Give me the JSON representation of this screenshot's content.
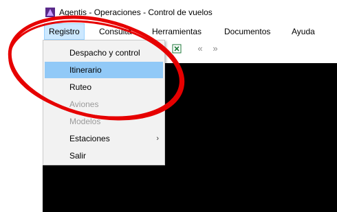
{
  "window": {
    "title": "Agentis - Operaciones - Control de vuelos",
    "icon": "app-icon"
  },
  "menubar": {
    "items": [
      {
        "label": "Registro"
      },
      {
        "label": "Consulta"
      },
      {
        "label": "Herramientas"
      },
      {
        "label": "Documentos"
      },
      {
        "label": "Ayuda"
      }
    ]
  },
  "dropdown": {
    "items": [
      {
        "label": "Despacho y control",
        "state": "normal"
      },
      {
        "label": "Itinerario",
        "state": "highlighted"
      },
      {
        "label": "Ruteo",
        "state": "normal"
      },
      {
        "label": "Aviones",
        "state": "disabled"
      },
      {
        "label": "Modelos",
        "state": "disabled"
      },
      {
        "label": "Estaciones",
        "state": "normal",
        "has_submenu": true
      },
      {
        "label": "Salir",
        "state": "normal"
      }
    ],
    "submenu_arrow": "›"
  },
  "toolbar": {
    "icons": [
      "excel-export-icon",
      "previous-icon",
      "next-icon"
    ],
    "previous_glyph": "«",
    "next_glyph": "»"
  },
  "colors": {
    "highlight": "#91c9f7",
    "menubar_active": "#cce8ff",
    "workarea": "#000000",
    "annotation": "#e60000"
  }
}
